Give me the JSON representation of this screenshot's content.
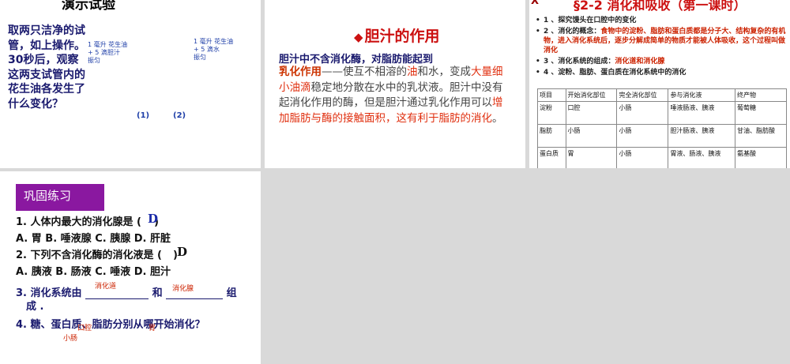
{
  "slide1": {
    "title": "演示试验",
    "body": "取两只洁净的试管，如上操作。30秒后，观察这两支试管内的花生油各发生了什么变化？",
    "tube1": [
      "1 毫升  花生油",
      "+ 5 滴胆汁",
      "振匀"
    ],
    "tube2": [
      "1 毫升  花生油",
      "+ 5 滴水",
      "振匀"
    ],
    "label1": "(1)",
    "label2": "(2)"
  },
  "slide2": {
    "diamond": "◆",
    "heading": "胆汁的作用",
    "subheading": "胆汁中不含消化酶，对脂肪能起到",
    "term": "乳化作用",
    "p1": "——使互不相溶的",
    "oil": "油",
    "p2": "和水，变成",
    "droplets": "大量细小油滴",
    "p3": "稳定地分散在水中的乳状液。胆汁中没有起消化作用的酶，但是胆汁通过乳化作用可以",
    "highlight": "增加脂肪与酶的接触面积，这有利于脂肪的消化",
    "p4": "。"
  },
  "slide3": {
    "mark": "X",
    "heading": "§2-2 消化和吸收（第一课时）",
    "items": [
      {
        "text": "1 、探究馒头在口腔中的变化",
        "red": ""
      },
      {
        "text": "2 、消化的概念：",
        "red": "食物中的淀粉、脂肪和蛋白质都是分子大、结构复杂的有机物，进入消化系统后，逐步分解成简单的物质才能被人体吸收，这个过程叫做消化"
      },
      {
        "text": "3 、消化系统的组成：",
        "red": "消化道和消化腺"
      },
      {
        "text": "4 、淀粉、脂肪、蛋白质在消化系统中的消化",
        "red": ""
      }
    ],
    "table": {
      "headers": [
        "项目",
        "开始消化部位",
        "完全消化部位",
        "参与消化液",
        "终产物"
      ],
      "rows": [
        [
          "淀粉",
          "口腔",
          "小肠",
          "唾液肠液、胰液",
          "葡萄糖"
        ],
        [
          "脂肪",
          "小肠",
          "小肠",
          "胆汁肠液、胰液",
          "甘油、脂肪酸"
        ],
        [
          "蛋白质",
          "胃",
          "小肠",
          "胃液、肠液、胰液",
          "氨基酸"
        ]
      ]
    }
  },
  "slide4": {
    "badge": "巩固练习",
    "q1": "1. 人体内最大的消化腺是 (",
    "q1_close": ")",
    "q1_answer": "D",
    "q1_options": "A. 胃     B. 唾液腺     C. 胰腺     D. 肝脏",
    "q2": "2. 下列不含消化酶的消化液是 (",
    "q2_close": ")",
    "q2_answer": "D",
    "q2_options": "A. 胰液     B. 肠液     C. 唾液     D. 胆汁",
    "q3_a": "3. 消化系统由",
    "q3_and": "和",
    "q3_b": "组",
    "q3_c": "成 .",
    "q3_ans1": "消化道",
    "q3_ans2": "消化腺",
    "q4": "4. 糖、蛋白质、脂肪分别从哪开始消化？",
    "q4_ans1": "口腔",
    "q4_ans2": "小肠",
    "q4_ans3": "胃"
  }
}
